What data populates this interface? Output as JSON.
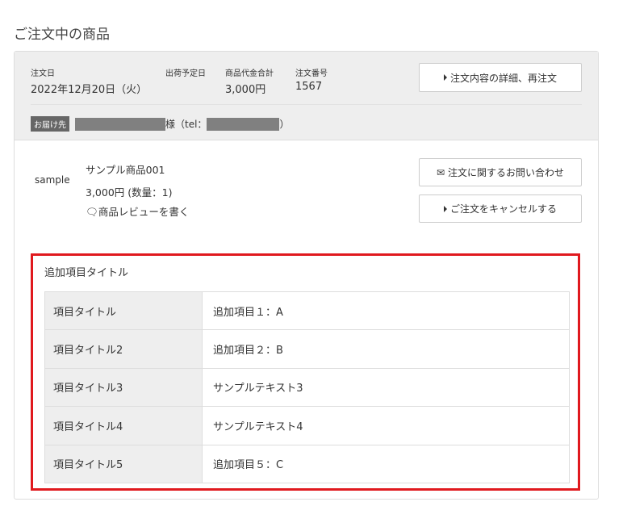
{
  "page_title": "ご注文中の商品",
  "order": {
    "date_label": "注文日",
    "date": "2022年12月20日（火）",
    "ship_label": "出荷予定日",
    "total_label": "商品代金合計",
    "total": "3,000円",
    "number_label": "注文番号",
    "number": "1567",
    "detail_button": "注文内容の詳細、再注文",
    "dest_badge": "お届け先",
    "dest_suffix": "様（tel：",
    "dest_close": "）"
  },
  "product": {
    "image_alt": "sample",
    "name": "サンプル商品001",
    "price": "3,000円 (数量：1)",
    "review_link": "商品レビューを書く",
    "inquiry_button": "注文に関するお問い合わせ",
    "cancel_button": "ご注文をキャンセルする"
  },
  "extra": {
    "title": "追加項目タイトル",
    "rows": [
      {
        "key": "項目タイトル",
        "value": "追加項目１：A"
      },
      {
        "key": "項目タイトル2",
        "value": "追加項目２：B"
      },
      {
        "key": "項目タイトル3",
        "value": "サンプルテキスト3"
      },
      {
        "key": "項目タイトル4",
        "value": "サンプルテキスト4"
      },
      {
        "key": "項目タイトル5",
        "value": "追加項目５：C"
      }
    ]
  },
  "colors": {
    "highlight": "#e0191e"
  }
}
